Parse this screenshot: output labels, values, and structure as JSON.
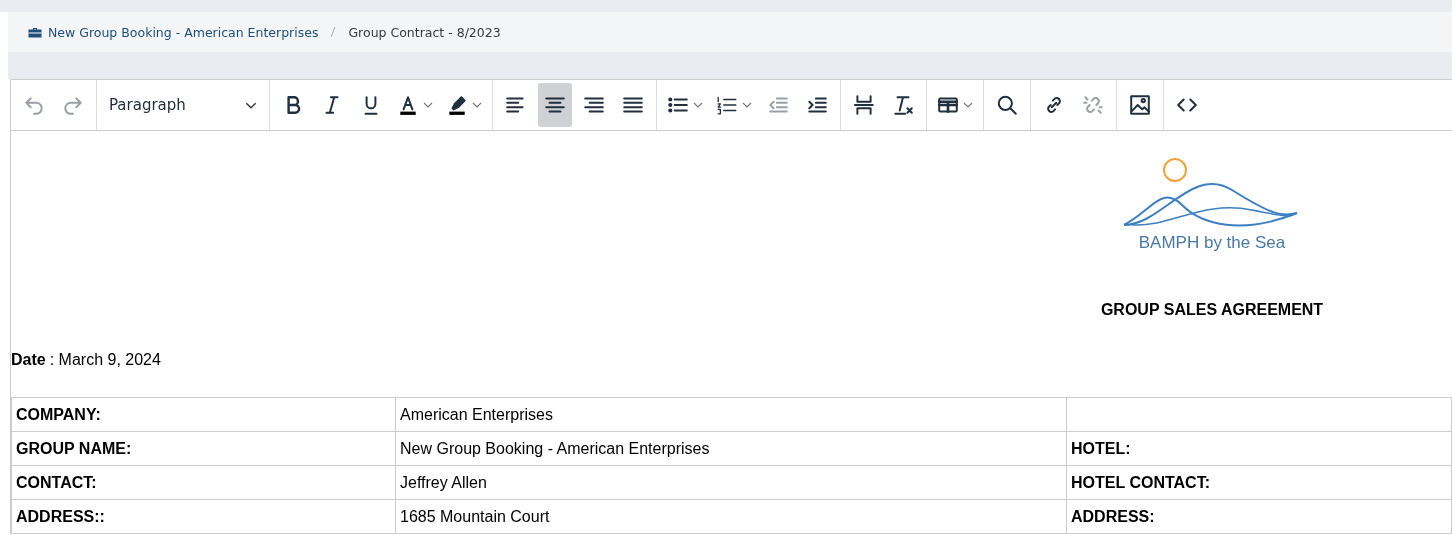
{
  "breadcrumb": [
    {
      "label": "New Group Booking - American Enterprises",
      "kind": "case"
    },
    {
      "label": "Group Contract - 8/2023",
      "kind": "plain"
    }
  ],
  "toolbar": {
    "groups": [
      [
        {
          "kind": "undo",
          "disabled": true
        },
        {
          "kind": "redo",
          "disabled": true
        }
      ],
      [
        {
          "kind": "format",
          "label": "Paragraph"
        }
      ],
      [
        {
          "kind": "bold",
          "disabled": false
        },
        {
          "kind": "italic",
          "disabled": false
        },
        {
          "kind": "underline",
          "disabled": false
        },
        {
          "kind": "text-color",
          "dropdown": true,
          "disabled": false
        },
        {
          "kind": "highlight",
          "dropdown": true,
          "disabled": false
        }
      ],
      [
        {
          "kind": "align-left",
          "selected": false
        },
        {
          "kind": "align-center",
          "selected": true
        },
        {
          "kind": "align-right",
          "selected": false
        },
        {
          "kind": "justify",
          "selected": false
        }
      ],
      [
        {
          "kind": "bullets",
          "dropdown": true,
          "disabled": false
        },
        {
          "kind": "numbers",
          "dropdown": true,
          "disabled": false
        },
        {
          "kind": "outdent",
          "disabled": true
        },
        {
          "kind": "indent",
          "disabled": false
        }
      ],
      [
        {
          "kind": "page-break",
          "disabled": false
        },
        {
          "kind": "clear-format",
          "disabled": false
        }
      ],
      [
        {
          "kind": "table",
          "dropdown": true,
          "disabled": false
        }
      ],
      [
        {
          "kind": "search",
          "disabled": false
        }
      ],
      [
        {
          "kind": "link",
          "disabled": false
        },
        {
          "kind": "unlink",
          "disabled": true
        }
      ],
      [
        {
          "kind": "image",
          "disabled": false
        }
      ],
      [
        {
          "kind": "code",
          "disabled": false
        }
      ]
    ]
  },
  "document": {
    "logo_text": "BAMPH by the Sea",
    "title": "GROUP SALES AGREEMENT",
    "date_label": "Date",
    "date_value": ": March 9, 2024",
    "table": {
      "rows": [
        {
          "label": "COMPANY:",
          "value": "American Enterprises"
        },
        {
          "label": "GROUP NAME:",
          "value": "New Group Booking - American Enterprises",
          "hotel_label": "HOTEL:"
        },
        {
          "label": "CONTACT:",
          "value": "Jeffrey Allen",
          "hotel_label": "HOTEL CONTACT:"
        },
        {
          "label": "ADDRESS::",
          "value": "1685 Mountain Court",
          "hotel_label": "ADDRESS:"
        }
      ]
    }
  }
}
